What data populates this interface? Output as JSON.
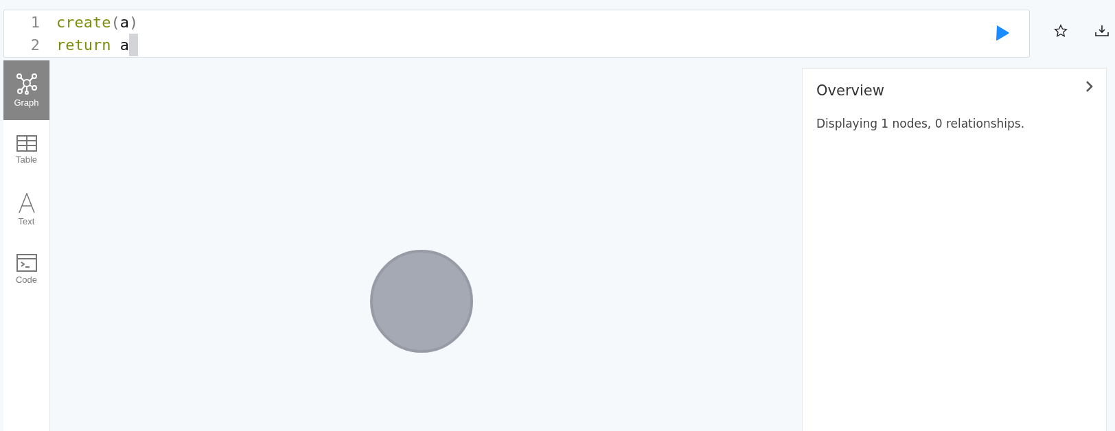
{
  "editor": {
    "lines": [
      {
        "number": "1",
        "cursor": false,
        "tokens": [
          {
            "kind": "keyword",
            "text": "create"
          },
          {
            "kind": "punct",
            "text": "("
          },
          {
            "kind": "ident",
            "text": "a"
          },
          {
            "kind": "punct",
            "text": ")"
          }
        ]
      },
      {
        "number": "2",
        "cursor": true,
        "tokens": [
          {
            "kind": "keyword",
            "text": "return"
          },
          {
            "kind": "spaced",
            "text": "a"
          }
        ]
      }
    ]
  },
  "sidebar": {
    "items": [
      {
        "kind": "graph",
        "label": "Graph",
        "selected": true
      },
      {
        "kind": "table",
        "label": "Table",
        "selected": false
      },
      {
        "kind": "text",
        "label": "Text",
        "selected": false
      },
      {
        "kind": "code",
        "label": "Code",
        "selected": false
      }
    ]
  },
  "graph": {
    "nodes": [
      {
        "kind": "node"
      }
    ]
  },
  "overview": {
    "title": "Overview",
    "summary": "Displaying 1 nodes, 0 relationships."
  }
}
